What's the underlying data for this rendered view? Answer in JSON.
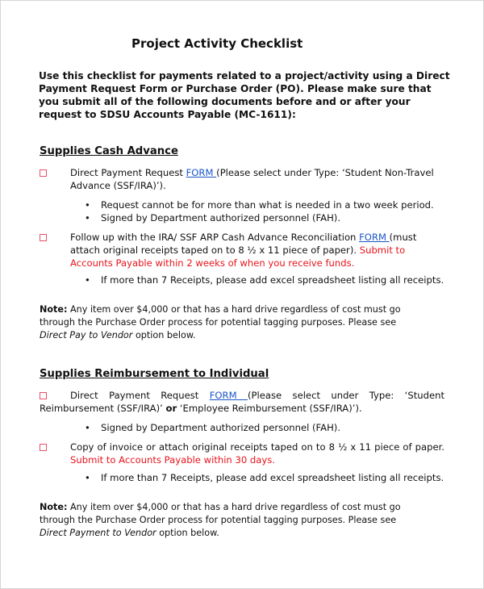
{
  "document": {
    "title": "Project Activity Checklist",
    "intro": "Use this checklist for payments related to a project/activity using a Direct Payment Request Form or Purchase Order (PO). Please make sure that you submit all of the following documents before and or after your request to SDSU Accounts Payable (MC-1611):",
    "sections": [
      {
        "heading": "Supplies Cash Advance",
        "items": [
          {
            "checkbox_icon": "empty-square",
            "text_before": "Direct Payment Request ",
            "link": "FORM ",
            "text_after": "(Please select under Type: ‘Student Non-Travel Advance (SSF/IRA)’).",
            "bullets": [
              "Request cannot be for more than what is needed in a two week period.",
              "Signed by Department authorized personnel (FAH)."
            ]
          },
          {
            "checkbox_icon": "empty-square",
            "text_before": "Follow up with the IRA/ SSF ARP Cash Advance Reconciliation ",
            "link": "FORM ",
            "text_after": "(must attach original receipts taped on to 8 ½ x 11 piece of paper). ",
            "red_text": "Submit to Accounts Payable within 2 weeks of when you receive funds.",
            "bullets": [
              "If more than 7 Receipts, please add excel spreadsheet listing all receipts."
            ]
          }
        ],
        "note": {
          "label": "Note:",
          "text": " Any item over $4,000 or that has a hard drive regardless of cost must go through the Purchase Order process for potential tagging purposes. Please see ",
          "italic": "Direct Pay to Vendor",
          "tail": " option below."
        }
      },
      {
        "heading": "Supplies Reimbursement to Individual",
        "items": [
          {
            "checkbox_icon": "empty-square",
            "text_before": "Direct Payment Request ",
            "link": "FORM ",
            "text_after": "(Please select under Type: ‘Student Reimbursement (SSF/IRA)’ ",
            "bold_text": "or",
            "text_after2": " ‘Employee Reimbursement (SSF/IRA)’).",
            "bullets": [
              "Signed by Department authorized personnel (FAH)."
            ]
          },
          {
            "checkbox_icon": "empty-square",
            "text_before": "Copy of invoice or attach original receipts taped on to 8 ½ x 11 piece of paper. ",
            "red_text": "Submit to Accounts Payable within 30 days.",
            "bullets": [
              "If more than 7 Receipts, please add excel spreadsheet listing all receipts."
            ]
          }
        ],
        "note": {
          "label": "Note:",
          "text": " Any item over $4,000 or that has a hard drive regardless of cost must go through the Purchase Order process for potential tagging purposes. Please see ",
          "italic": "Direct Payment to Vendor",
          "tail": " option below."
        }
      }
    ],
    "bullet_glyph": "•",
    "colors": {
      "link": "#1a55c9",
      "deadline_red": "#e8141c",
      "checkbox": "#e8506a"
    }
  }
}
